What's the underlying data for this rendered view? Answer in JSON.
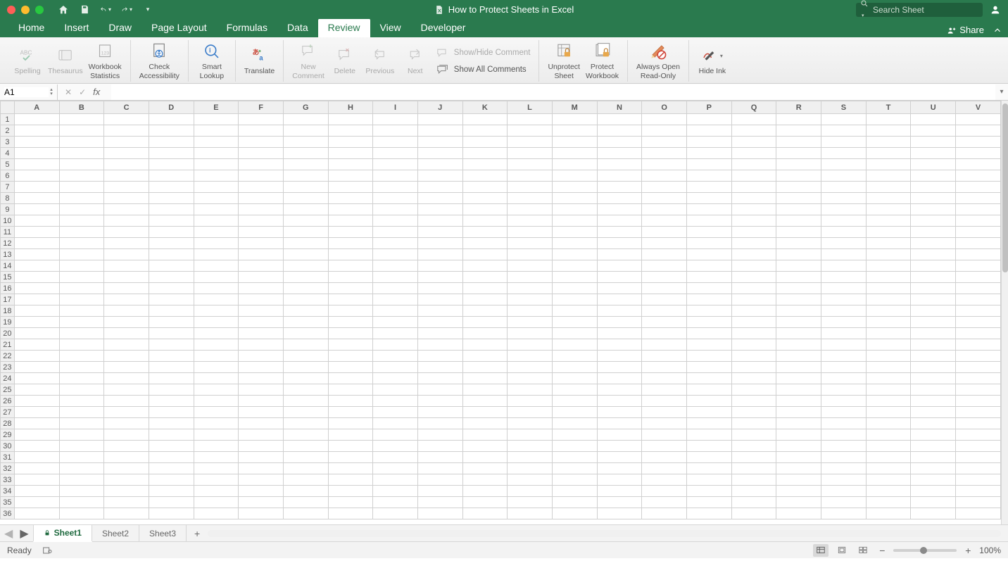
{
  "title": "How to Protect Sheets in Excel",
  "search_placeholder": "Search Sheet",
  "tabs": [
    "Home",
    "Insert",
    "Draw",
    "Page Layout",
    "Formulas",
    "Data",
    "Review",
    "View",
    "Developer"
  ],
  "active_tab": "Review",
  "share_label": "Share",
  "ribbon": {
    "spelling": "Spelling",
    "thesaurus": "Thesaurus",
    "workbook_statistics": "Workbook\nStatistics",
    "check_accessibility": "Check\nAccessibility",
    "smart_lookup": "Smart\nLookup",
    "translate": "Translate",
    "new_comment": "New\nComment",
    "delete": "Delete",
    "previous": "Previous",
    "next": "Next",
    "show_hide_comment": "Show/Hide Comment",
    "show_all_comments": "Show All Comments",
    "unprotect_sheet": "Unprotect\nSheet",
    "protect_workbook": "Protect\nWorkbook",
    "always_open_readonly": "Always Open\nRead-Only",
    "hide_ink": "Hide Ink"
  },
  "cell_ref": "A1",
  "columns": [
    "A",
    "B",
    "C",
    "D",
    "E",
    "F",
    "G",
    "H",
    "I",
    "J",
    "K",
    "L",
    "M",
    "N",
    "O",
    "P",
    "Q",
    "R",
    "S",
    "T",
    "U",
    "V"
  ],
  "row_count": 36,
  "sheets": [
    "Sheet1",
    "Sheet2",
    "Sheet3"
  ],
  "active_sheet": "Sheet1",
  "status_text": "Ready",
  "zoom_label": "100%"
}
